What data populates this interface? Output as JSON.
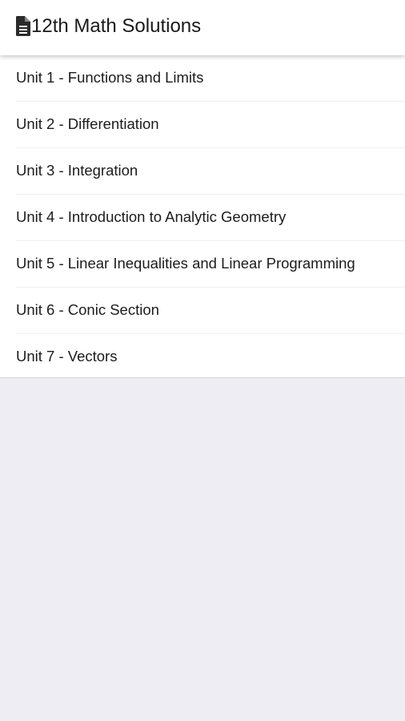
{
  "header": {
    "icon": "document-icon",
    "title": "12th Math Solutions"
  },
  "units": [
    {
      "label": "Unit 1 - Functions and Limits"
    },
    {
      "label": "Unit 2 - Differentiation"
    },
    {
      "label": "Unit 3 - Integration"
    },
    {
      "label": "Unit 4 - Introduction to Analytic Geometry"
    },
    {
      "label": "Unit 5 - Linear Inequalities and Linear Programming"
    },
    {
      "label": "Unit 6 - Conic Section"
    },
    {
      "label": "Unit 7 - Vectors"
    }
  ],
  "colors": {
    "background": "#efedf4",
    "surface": "#ffffff",
    "text": "#1c1c1c",
    "icon": "#2b2b2b"
  }
}
